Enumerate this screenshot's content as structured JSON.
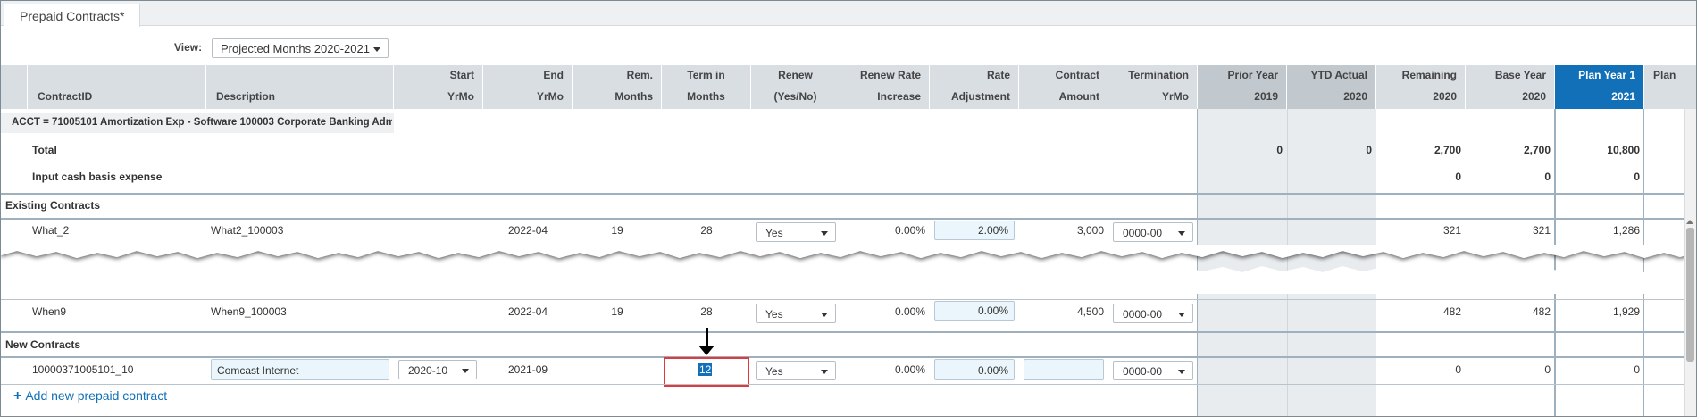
{
  "tab": {
    "label": "Prepaid Contracts*"
  },
  "view": {
    "label": "View:",
    "value": "Projected  Months 2020-2021"
  },
  "columns": [
    {
      "l1": "",
      "l2": "ContractID"
    },
    {
      "l1": "",
      "l2": "Description"
    },
    {
      "l1": "Start",
      "l2": "YrMo"
    },
    {
      "l1": "End",
      "l2": "YrMo"
    },
    {
      "l1": "Rem.",
      "l2": "Months"
    },
    {
      "l1": "Term in",
      "l2": "Months"
    },
    {
      "l1": "Renew",
      "l2": "(Yes/No)"
    },
    {
      "l1": "Renew Rate",
      "l2": "Increase"
    },
    {
      "l1": "Rate",
      "l2": "Adjustment"
    },
    {
      "l1": "Contract",
      "l2": "Amount"
    },
    {
      "l1": "Termination",
      "l2": "YrMo"
    },
    {
      "l1": "Prior Year",
      "l2": "2019"
    },
    {
      "l1": "YTD Actual",
      "l2": "2020"
    },
    {
      "l1": "Remaining",
      "l2": "2020"
    },
    {
      "l1": "Base Year",
      "l2": "2020"
    },
    {
      "l1": "Plan Year 1",
      "l2": "2021"
    },
    {
      "l1": "Plan",
      "l2": ""
    }
  ],
  "acct_label": "ACCT = 71005101 Amortization Exp - Software 100003 Corporate Banking Adm",
  "total": {
    "label": "Total",
    "prior": "0",
    "ytd": "0",
    "remaining": "2,700",
    "base": "2,700",
    "plan1": "10,800"
  },
  "cash": {
    "label": "Input cash basis expense",
    "remaining": "0",
    "base": "0",
    "plan1": "0"
  },
  "existing": {
    "label": "Existing Contracts",
    "rows": [
      {
        "id": "What_2",
        "desc": "What2_100003",
        "end": "2022-04",
        "rem": "19",
        "term": "28",
        "renew": "Yes",
        "renew_rate": "0.00%",
        "rate_adj": "2.00%",
        "amount": "3,000",
        "termination": "0000-00",
        "remaining": "321",
        "base": "321",
        "plan1": "1,286"
      },
      {
        "id": "When9",
        "desc": "When9_100003",
        "end": "2022-04",
        "rem": "19",
        "term": "28",
        "renew": "Yes",
        "renew_rate": "0.00%",
        "rate_adj": "0.00%",
        "amount": "4,500",
        "termination": "0000-00",
        "remaining": "482",
        "base": "482",
        "plan1": "1,929"
      }
    ]
  },
  "new": {
    "label": "New Contracts",
    "rows": [
      {
        "id": "10000371005101_10",
        "desc": "Comcast Internet",
        "start": "2020-10",
        "end": "2021-09",
        "term": "12",
        "renew": "Yes",
        "renew_rate": "0.00%",
        "rate_adj": "0.00%",
        "amount": "",
        "termination": "0000-00",
        "remaining": "0",
        "base": "0",
        "plan1": "0"
      }
    ]
  },
  "add_link": {
    "icon": "plus-icon",
    "label": "Add new prepaid contract"
  },
  "colors": {
    "accent": "#1170b8",
    "highlight": "#e0393e",
    "input_bg": "#eaf6fb",
    "header_bg": "#d9dee3"
  }
}
